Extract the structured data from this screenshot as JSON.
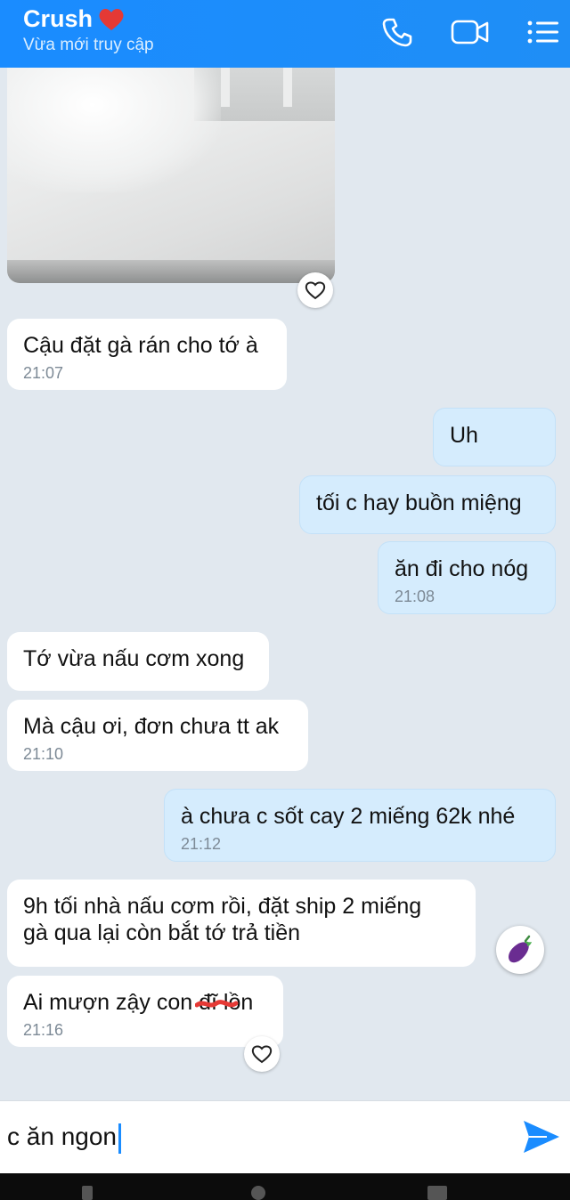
{
  "header": {
    "title": "Crush",
    "status": "Vừa mới truy cập",
    "accent": "#1a8cff",
    "icons": [
      "heart-icon",
      "phone-icon",
      "video-call-icon",
      "menu-icon"
    ]
  },
  "messages": [
    {
      "dir": "in",
      "text": "Cậu đặt gà rán cho tớ à",
      "time": "21:07"
    },
    {
      "dir": "out",
      "text": "Uh",
      "time": ""
    },
    {
      "dir": "out",
      "text": "tối c hay buồn miệng",
      "time": ""
    },
    {
      "dir": "out",
      "text": "ăn đi cho nóg",
      "time": "21:08"
    },
    {
      "dir": "in",
      "text": "Tớ vừa nấu cơm xong",
      "time": ""
    },
    {
      "dir": "in",
      "text": "Mà cậu ơi, đơn chưa tt ak",
      "time": "21:10"
    },
    {
      "dir": "out",
      "text": "à chưa c sốt cay 2 miếng 62k nhé",
      "time": "21:12"
    },
    {
      "dir": "in",
      "text_line1": "9h tối nhà nấu cơm rồi, đặt ship 2 miếng",
      "text_line2": "gà qua lại còn bắt tớ trả tiền",
      "time": "",
      "reaction": "eggplant-icon"
    },
    {
      "dir": "in",
      "text_a": "Ai mượn zậy con ",
      "text_b": "đĩ lồn",
      "time": "21:16"
    }
  ],
  "input": {
    "value": "c ăn ngon"
  },
  "icons": {
    "like": "heart-outline-icon",
    "send": "send-icon"
  }
}
